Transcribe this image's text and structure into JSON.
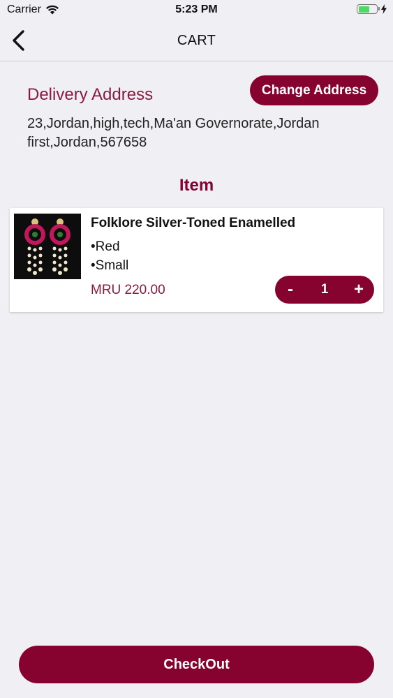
{
  "status_bar": {
    "carrier": "Carrier",
    "time": "5:23 PM"
  },
  "nav": {
    "title": "CART"
  },
  "delivery": {
    "label": "Delivery Address",
    "change_button": "Change Address",
    "address_line1": "23,Jordan,high,tech,Ma'an Governorate,Jordan",
    "address_line2": "first,Jordan,567658"
  },
  "items_section": {
    "title": "Item"
  },
  "cart_items": [
    {
      "name": "Folklore Silver-Toned Enamelled",
      "color": "•Red",
      "size": "•Small",
      "price": "MRU 220.00",
      "quantity": "1",
      "minus_label": "-",
      "plus_label": "+"
    }
  ],
  "checkout": {
    "label": "CheckOut"
  },
  "colors": {
    "accent": "#86032f",
    "label": "#8b1a3e",
    "background": "#efeff4"
  },
  "icons": {
    "back": "chevron-left-icon",
    "wifi": "wifi-icon",
    "battery": "battery-icon",
    "charging": "bolt-icon"
  }
}
